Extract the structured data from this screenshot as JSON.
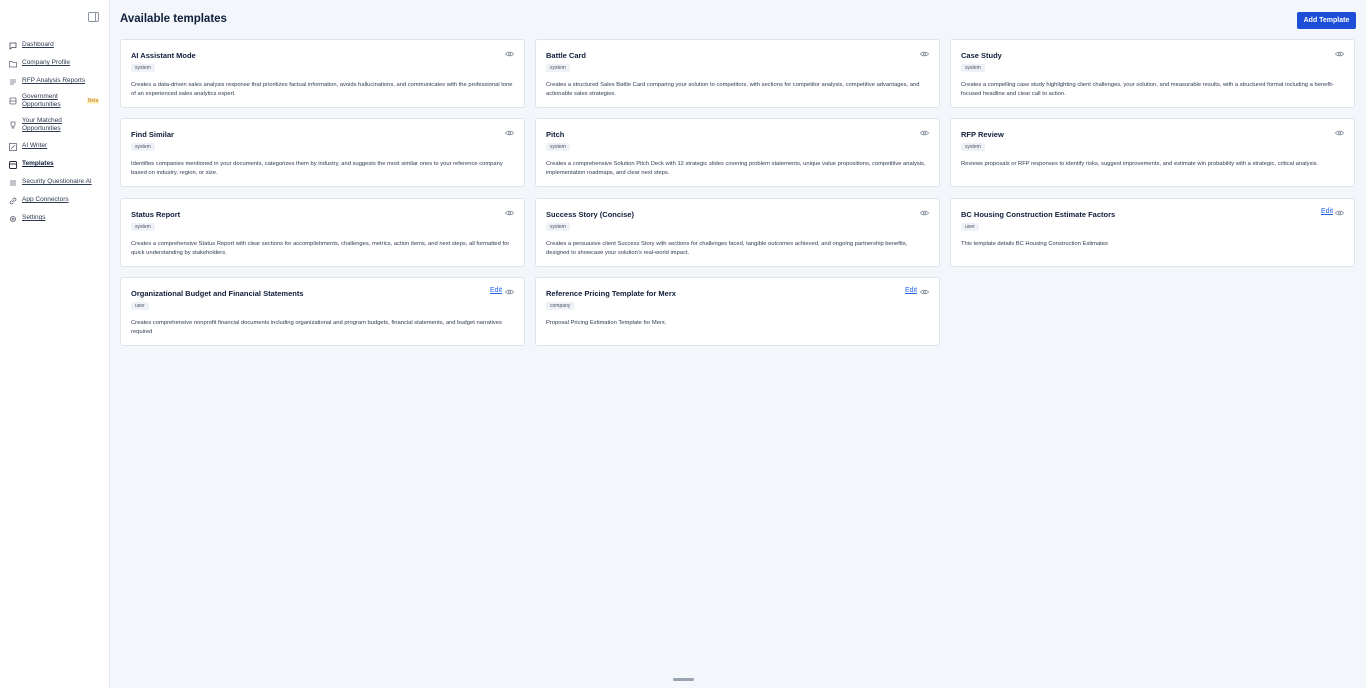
{
  "sidebar": {
    "items": [
      {
        "label": "Dashboard",
        "icon": "chat-icon"
      },
      {
        "label": "Company Profile",
        "icon": "folder-icon"
      },
      {
        "label": "RFP Analysis Reports",
        "icon": "list-icon"
      },
      {
        "label": "Government Opportunities",
        "icon": "database-icon",
        "badge": "Beta"
      },
      {
        "label": "Your Matched Opportunities",
        "icon": "trophy-icon"
      },
      {
        "label": "AI Writer",
        "icon": "pencil-icon"
      },
      {
        "label": "Templates",
        "icon": "template-icon"
      },
      {
        "label": "Security Questionaire AI",
        "icon": "shield-icon"
      },
      {
        "label": "App Connectors",
        "icon": "link-icon"
      },
      {
        "label": "Settings",
        "icon": "gear-icon"
      }
    ],
    "active": "Templates"
  },
  "header": {
    "title": "Available templates",
    "add_button": "Add Template"
  },
  "templates": [
    {
      "title": "AI Assistant Mode",
      "tag": "system",
      "description": "Creates a data-driven sales analysis response that prioritizes factual information, avoids hallucinations, and communicates with the professional tone of an experienced sales analytics expert.",
      "editable": false
    },
    {
      "title": "Battle Card",
      "tag": "system",
      "description": "Creates a structured Sales Battle Card comparing your solution to competitors, with sections for competitor analysis, competitive advantages, and actionable sales strategies.",
      "editable": false
    },
    {
      "title": "Case Study",
      "tag": "system",
      "description": "Creates a compelling case study highlighting client challenges, your solution, and measurable results, with a structured format including a benefit-focused headline and clear call to action.",
      "editable": false
    },
    {
      "title": "Find Similar",
      "tag": "system",
      "description": "Identifies companies mentioned in your documents, categorizes them by industry, and suggests the most similar ones to your reference company based on industry, region, or size.",
      "editable": false
    },
    {
      "title": "Pitch",
      "tag": "system",
      "description": "Creates a comprehensive Solution Pitch Deck with 12 strategic slides covering problem statements, unique value propositions, competitive analysis, implementation roadmaps, and clear next steps.",
      "editable": false
    },
    {
      "title": "RFP Review",
      "tag": "system",
      "description": "Reviews proposals or RFP responses to identify risks, suggest improvements, and estimate win probability with a strategic, critical analysis.",
      "editable": false
    },
    {
      "title": "Status Report",
      "tag": "system",
      "description": "Creates a comprehensive Status Report with clear sections for accomplishments, challenges, metrics, action items, and next steps, all formatted for quick understanding by stakeholders.",
      "editable": false
    },
    {
      "title": "Success Story (Concise)",
      "tag": "system",
      "description": "Creates a persuasive client Success Story with sections for challenges faced, tangible outcomes achieved, and ongoing partnership benefits, designed to showcase your solution's real-world impact.",
      "editable": false
    },
    {
      "title": "BC Housing Construction Estimate Factors",
      "tag": "user",
      "description": "This template details BC Housing Construction Estimates",
      "editable": true
    },
    {
      "title": "Organizational Budget and Financial Statements",
      "tag": "user",
      "description": "Creates comprehensive nonprofit financial documents including organizational and program budgets, financial statements, and budget narratives required",
      "editable": true
    },
    {
      "title": "Reference Pricing Template for Merx",
      "tag": "company",
      "description": "Proposal Pricing Estimation Template for Merx.",
      "editable": true
    }
  ],
  "edit_label": "Edit",
  "colors": {
    "accent": "#1d4ed8",
    "link": "#2563eb",
    "background": "#f3f6fa",
    "beta": "#b7791f"
  }
}
